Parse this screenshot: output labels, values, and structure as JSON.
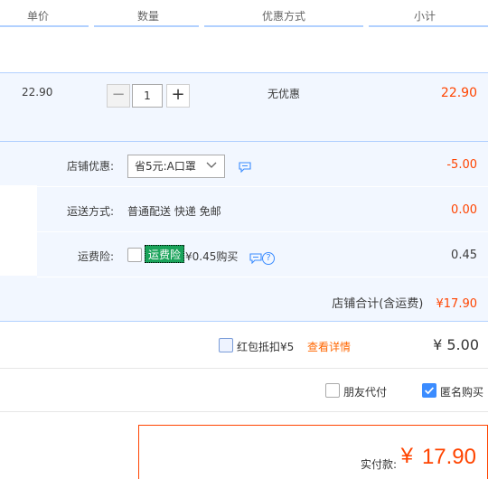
{
  "header": {
    "unit_price": "单价",
    "quantity": "数量",
    "promotion": "优惠方式",
    "subtotal": "小计"
  },
  "item": {
    "unit_price": "22.90",
    "quantity": "1",
    "minus": "−",
    "plus": "+",
    "promotion": "无优惠",
    "subtotal": "22.90"
  },
  "shop": {
    "coupon_label": "店铺优惠:",
    "coupon_selected": "省5元:A口罩",
    "coupon_amount": "-5.00",
    "shipping_label": "运送方式:",
    "shipping_text": "普通配送 快递 免邮",
    "shipping_amount": "0.00",
    "insurance_label": "运费险:",
    "insurance_tag": "运费险",
    "insurance_text": "¥0.45购买",
    "insurance_amount": "0.45",
    "total_label": "店铺合计(含运费)",
    "total_value": "¥17.90"
  },
  "red_packet": {
    "label": "红包抵扣¥5",
    "link": "查看详情",
    "amount": "¥ 5.00"
  },
  "options": {
    "friend_pay": "朋友代付",
    "anonymous": "匿名购买",
    "anonymous_checked": true
  },
  "pay": {
    "label": "实付款:",
    "currency": "¥",
    "value": "17.90"
  },
  "colors": {
    "accent_red": "#ff4400",
    "accent_blue": "#3b8cff",
    "row_bg": "#f2f7ff",
    "tag_green": "#1aa35a"
  }
}
